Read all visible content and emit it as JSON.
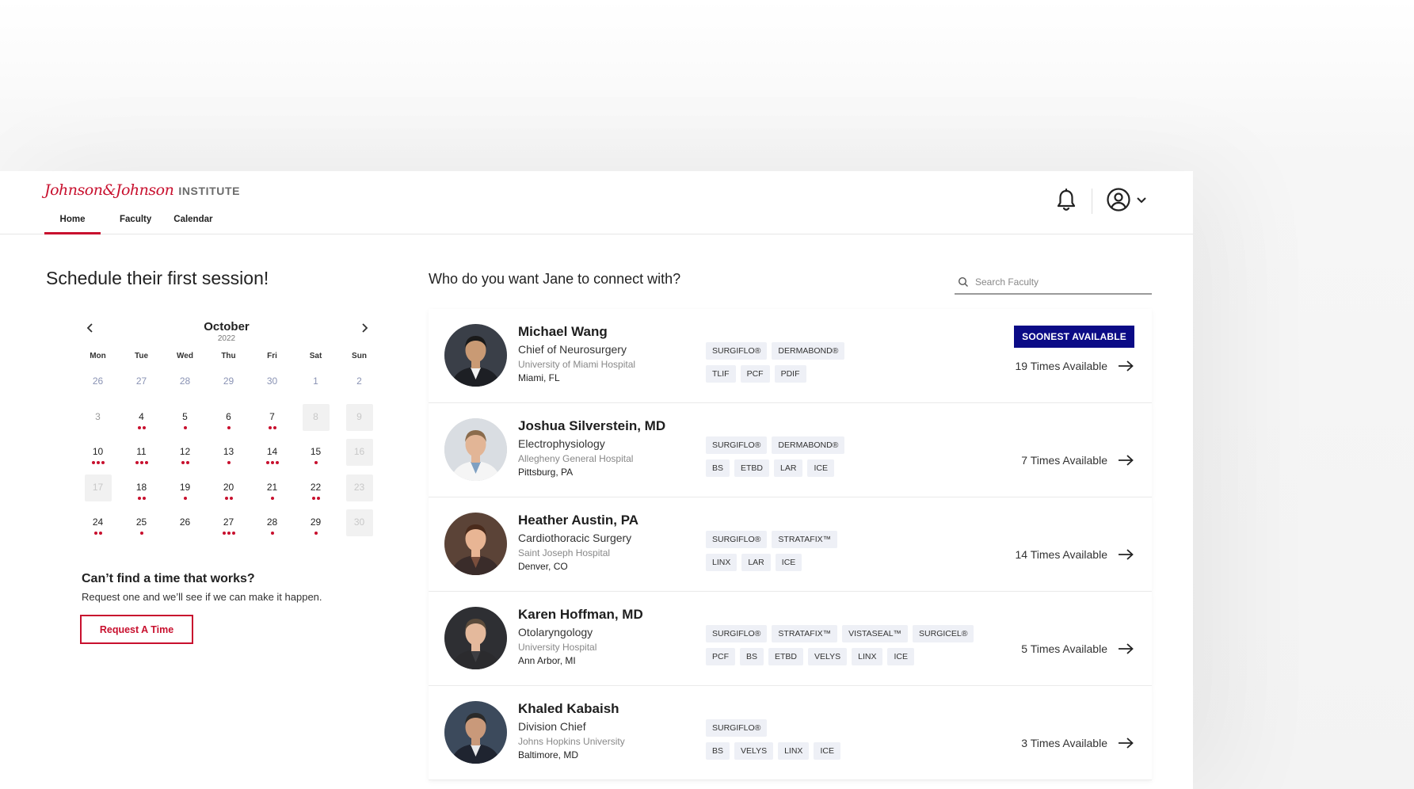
{
  "header": {
    "logo_script": "Johnson&Johnson",
    "logo_institute": "INSTITUTE",
    "nav": [
      {
        "label": "Home",
        "active": true
      },
      {
        "label": "Faculty",
        "active": false
      },
      {
        "label": "Calendar",
        "active": false
      }
    ],
    "icons": [
      "bell-icon",
      "user-circle-icon",
      "chevron-down-icon"
    ]
  },
  "left": {
    "title": "Schedule their first session!",
    "calendar": {
      "month": "October",
      "year": "2022",
      "weekdays": [
        "Mon",
        "Tue",
        "Wed",
        "Thu",
        "Fri",
        "Sat",
        "Sun"
      ],
      "days": [
        {
          "d": "26",
          "state": "prev",
          "dots": 0
        },
        {
          "d": "27",
          "state": "prev",
          "dots": 0
        },
        {
          "d": "28",
          "state": "prev",
          "dots": 0
        },
        {
          "d": "29",
          "state": "prev",
          "dots": 0
        },
        {
          "d": "30",
          "state": "prev",
          "dots": 0
        },
        {
          "d": "1",
          "state": "prev",
          "dots": 0
        },
        {
          "d": "2",
          "state": "prev",
          "dots": 0
        },
        {
          "d": "3",
          "state": "gray",
          "dots": 0
        },
        {
          "d": "4",
          "state": "normal",
          "dots": 2
        },
        {
          "d": "5",
          "state": "normal",
          "dots": 1
        },
        {
          "d": "6",
          "state": "normal",
          "dots": 1
        },
        {
          "d": "7",
          "state": "normal",
          "dots": 2
        },
        {
          "d": "8",
          "state": "off",
          "dots": 0
        },
        {
          "d": "9",
          "state": "off",
          "dots": 0
        },
        {
          "d": "10",
          "state": "normal",
          "dots": 3
        },
        {
          "d": "11",
          "state": "normal",
          "dots": 3
        },
        {
          "d": "12",
          "state": "normal",
          "dots": 2
        },
        {
          "d": "13",
          "state": "normal",
          "dots": 1
        },
        {
          "d": "14",
          "state": "normal",
          "dots": 3
        },
        {
          "d": "15",
          "state": "normal",
          "dots": 1
        },
        {
          "d": "16",
          "state": "off",
          "dots": 0
        },
        {
          "d": "17",
          "state": "off",
          "dots": 0
        },
        {
          "d": "18",
          "state": "normal",
          "dots": 2
        },
        {
          "d": "19",
          "state": "normal",
          "dots": 1
        },
        {
          "d": "20",
          "state": "normal",
          "dots": 2
        },
        {
          "d": "21",
          "state": "normal",
          "dots": 1
        },
        {
          "d": "22",
          "state": "normal",
          "dots": 2
        },
        {
          "d": "23",
          "state": "off",
          "dots": 0
        },
        {
          "d": "24",
          "state": "normal",
          "dots": 2
        },
        {
          "d": "25",
          "state": "normal",
          "dots": 1
        },
        {
          "d": "26",
          "state": "normal",
          "dots": 0
        },
        {
          "d": "27",
          "state": "normal",
          "dots": 3
        },
        {
          "d": "28",
          "state": "normal",
          "dots": 1
        },
        {
          "d": "29",
          "state": "normal",
          "dots": 1
        },
        {
          "d": "30",
          "state": "off",
          "dots": 0
        }
      ]
    },
    "cant_find": {
      "title": "Can’t find a time that works?",
      "subtitle": "Request one and we’ll see if we can make it happen.",
      "button": "Request A Time"
    }
  },
  "right": {
    "title": "Who do you want Jane to connect with?",
    "search_placeholder": "Search Faculty",
    "faculty": [
      {
        "name": "Michael Wang",
        "specialty": "Chief of Neurosurgery",
        "hospital": "University of Miami Hospital",
        "location": "Miami, FL",
        "tags_row1": [
          "SURGIFLO®",
          "DERMABOND®"
        ],
        "tags_row2": [
          "TLIF",
          "PCF",
          "PDIF"
        ],
        "badge": "SOONEST AVAILABLE",
        "availability": "19 Times Available"
      },
      {
        "name": "Joshua Silverstein, MD",
        "specialty": "Electrophysiology",
        "hospital": "Allegheny General Hospital",
        "location": "Pittsburg, PA",
        "tags_row1": [
          "SURGIFLO®",
          "DERMABOND®"
        ],
        "tags_row2": [
          "BS",
          "ETBD",
          "LAR",
          "ICE"
        ],
        "badge": "",
        "availability": "7 Times Available"
      },
      {
        "name": "Heather Austin, PA",
        "specialty": "Cardiothoracic Surgery",
        "hospital": "Saint Joseph Hospital",
        "location": "Denver, CO",
        "tags_row1": [
          "SURGIFLO®",
          "STRATAFIX™"
        ],
        "tags_row2": [
          "LINX",
          "LAR",
          "ICE"
        ],
        "badge": "",
        "availability": "14 Times Available"
      },
      {
        "name": "Karen Hoffman, MD",
        "specialty": "Otolaryngology",
        "hospital": "University Hospital",
        "location": "Ann Arbor, MI",
        "tags_row1": [
          "SURGIFLO®",
          "STRATAFIX™",
          "VISTASEAL™",
          "SURGICEL®"
        ],
        "tags_row2": [
          "PCF",
          "BS",
          "ETBD",
          "VELYS",
          "LINX",
          "ICE"
        ],
        "badge": "",
        "availability": "5 Times Available"
      },
      {
        "name": "Khaled Kabaish",
        "specialty": "Division Chief",
        "hospital": "Johns Hopkins University",
        "location": "Baltimore, MD",
        "tags_row1": [
          "SURGIFLO®"
        ],
        "tags_row2": [
          "BS",
          "VELYS",
          "LINX",
          "ICE"
        ],
        "badge": "",
        "availability": "3 Times Available"
      }
    ]
  },
  "colors": {
    "brand_red": "#c8102e",
    "badge_navy": "#0b0b86",
    "tag_bg": "#eef0f6"
  }
}
